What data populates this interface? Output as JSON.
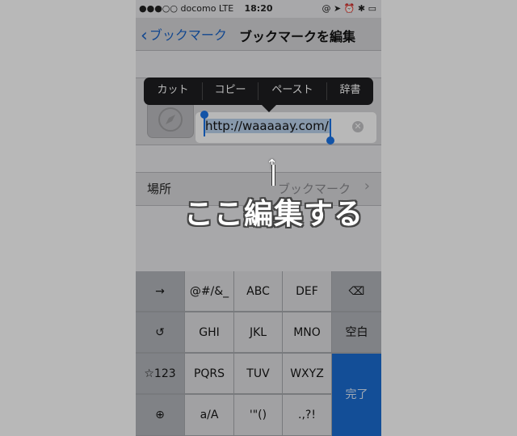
{
  "status_bar": {
    "carrier": "●●●○○ docomo  LTE",
    "time": "18:20",
    "icons": "@ ➤ ⏰ ✱ ▭"
  },
  "nav": {
    "back_label": "ブックマーク",
    "title": "ブックマークを編集"
  },
  "context_menu": {
    "items": [
      "カット",
      "コピー",
      "ペースト",
      "辞書"
    ]
  },
  "edit_form": {
    "url_value": "http://waaaaay.com/",
    "clear_icon": "clear-circle-icon"
  },
  "location_row": {
    "label": "場所",
    "value": "ブックマーク",
    "chevron": "›"
  },
  "annotation": {
    "arrow": "↑",
    "text": "ここ編集する"
  },
  "keyboard": {
    "rows": [
      [
        "→",
        "@#/&_",
        "ABC",
        "DEF",
        "⌫"
      ],
      [
        "↺",
        "GHI",
        "JKL",
        "MNO",
        "空白"
      ],
      [
        "☆123",
        "PQRS",
        "TUV",
        "WXYZ",
        ""
      ],
      [
        "⊕",
        "a/A",
        "'\"()",
        ".,?!",
        ""
      ]
    ],
    "done_label": "完了"
  },
  "colors": {
    "accent": "#1a63c6",
    "done_key": "#1b6cd1",
    "selection": "#bcd3ee"
  }
}
